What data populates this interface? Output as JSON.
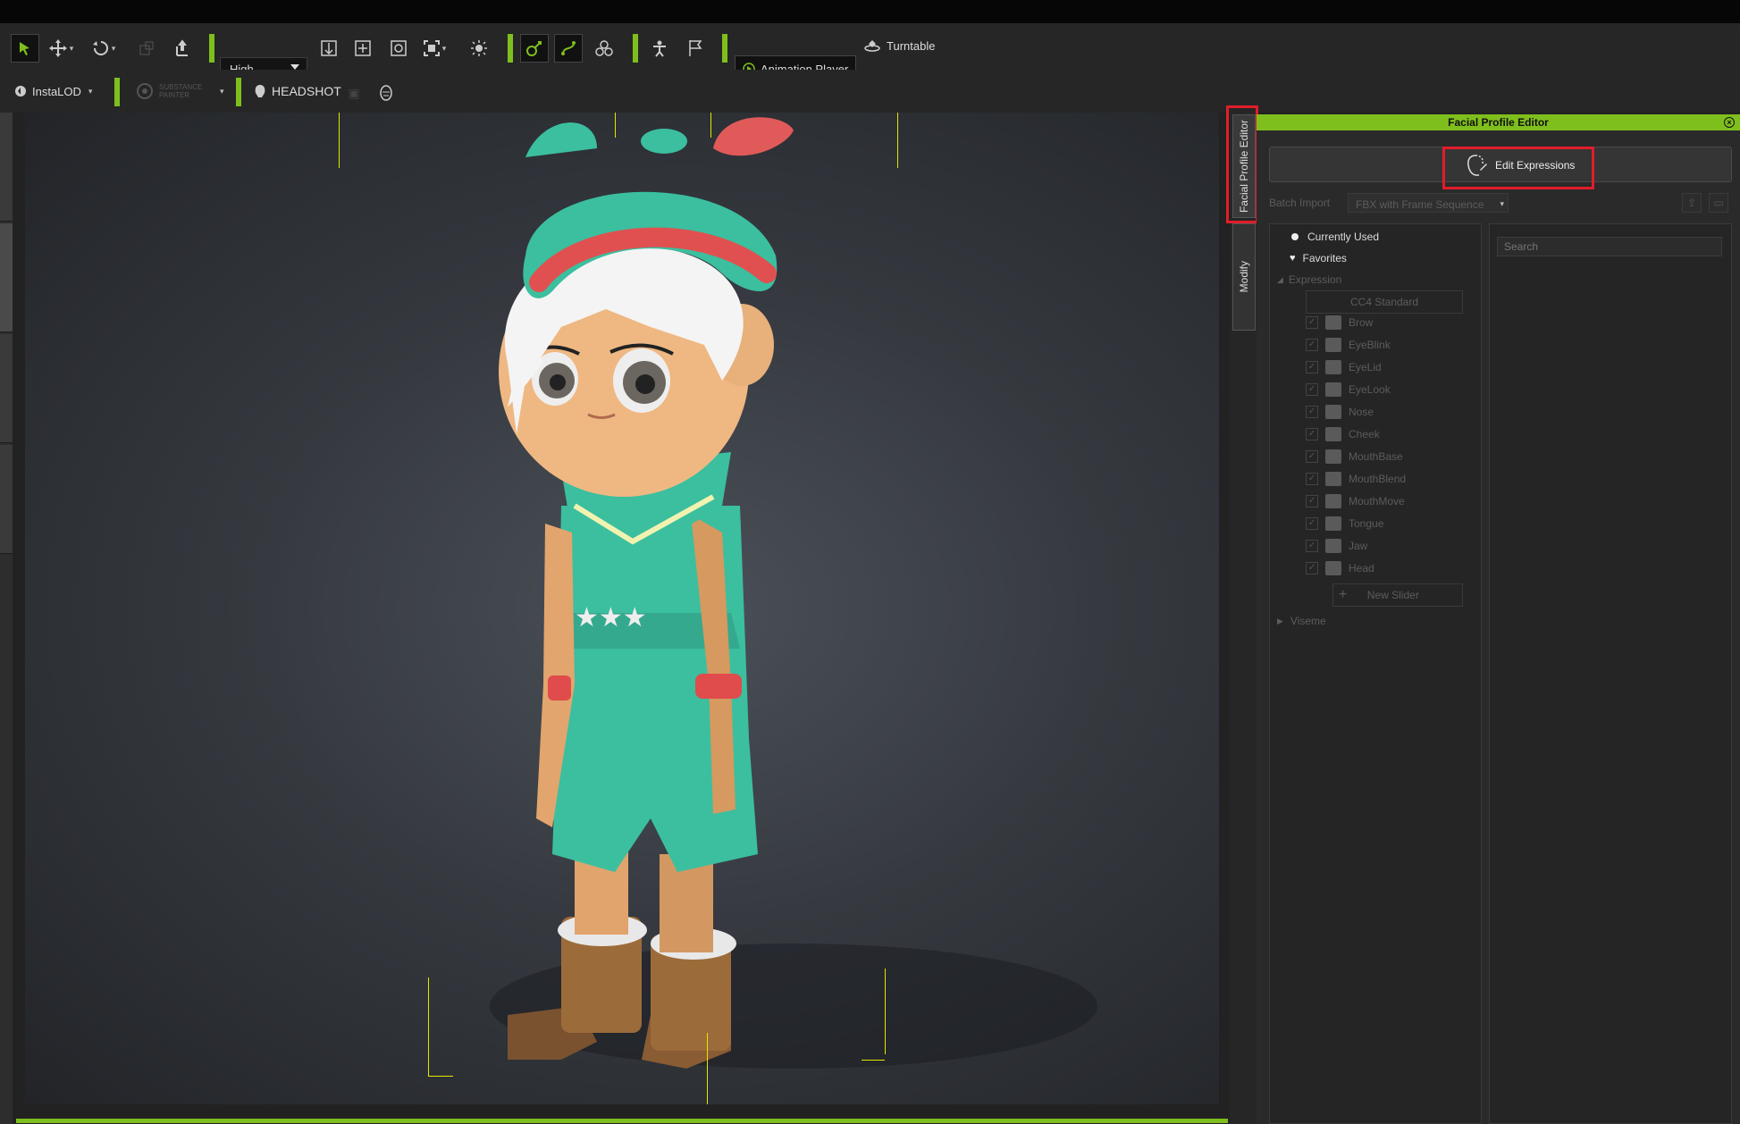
{
  "toolbar": {
    "quality": "High",
    "animation_player": "Animation Player",
    "turntable": "Turntable",
    "instalod": "InstaLOD",
    "substance_painter": "SUBSTANCE PAINTER",
    "headshot": "HEADSHOT"
  },
  "side_tabs": {
    "facial_profile_editor": "Facial Profile Editor",
    "modify": "Modify"
  },
  "panel": {
    "title": "Facial Profile Editor",
    "edit_expressions": "Edit Expressions",
    "batch_import_label": "Batch Import",
    "batch_import_value": "FBX with Frame Sequence",
    "search_placeholder": "Search",
    "currently_used": "Currently Used",
    "favorites": "Favorites",
    "expression_group": "Expression",
    "cc4_standard": "CC4 Standard",
    "items": [
      "Brow",
      "EyeBlink",
      "EyeLid",
      "EyeLook",
      "Nose",
      "Cheek",
      "MouthBase",
      "MouthBlend",
      "MouthMove",
      "Tongue",
      "Jaw",
      "Head"
    ],
    "new_slider": "New Slider",
    "viseme_group": "Viseme"
  },
  "colors": {
    "accent_green": "#7fbf1d",
    "highlight_red": "#e11d2a"
  }
}
